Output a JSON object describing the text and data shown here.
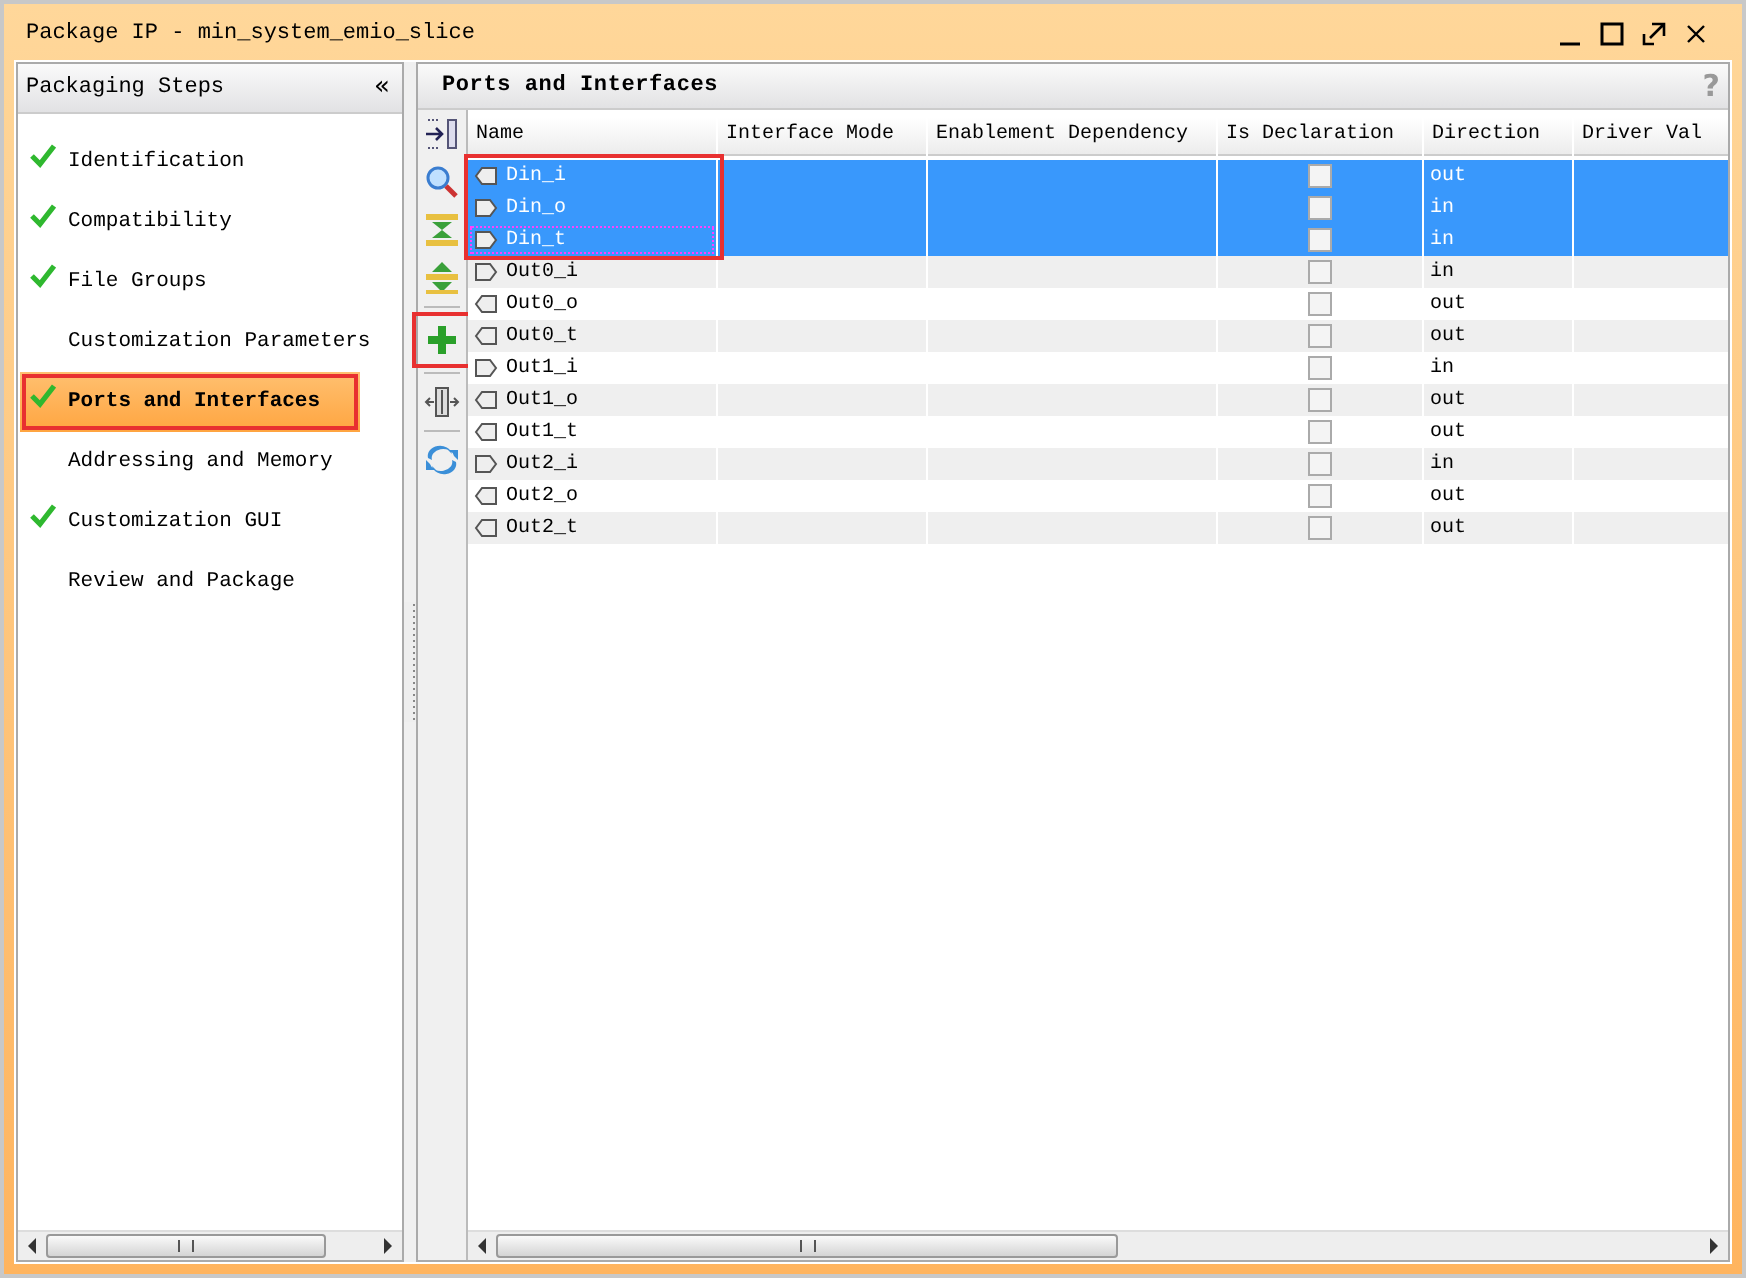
{
  "window": {
    "title": "Package IP - min_system_emio_slice"
  },
  "steps_panel": {
    "title": "Packaging Steps",
    "collapse": "«",
    "items": [
      {
        "label": "Identification",
        "done": true,
        "selected": false,
        "highlighted": false
      },
      {
        "label": "Compatibility",
        "done": true,
        "selected": false,
        "highlighted": false
      },
      {
        "label": "File Groups",
        "done": true,
        "selected": false,
        "highlighted": false
      },
      {
        "label": "Customization Parameters",
        "done": false,
        "selected": false,
        "highlighted": false
      },
      {
        "label": "Ports and Interfaces",
        "done": true,
        "selected": true,
        "highlighted": true
      },
      {
        "label": "Addressing and Memory",
        "done": false,
        "selected": false,
        "highlighted": false
      },
      {
        "label": "Customization GUI",
        "done": true,
        "selected": false,
        "highlighted": false
      },
      {
        "label": "Review and Package",
        "done": false,
        "selected": false,
        "highlighted": false
      }
    ]
  },
  "main_panel": {
    "title": "Ports and Interfaces",
    "help": "?"
  },
  "toolbar": [
    {
      "kind": "collapse",
      "highlighted": false
    },
    {
      "kind": "search",
      "highlighted": false
    },
    {
      "kind": "expand",
      "highlighted": false
    },
    {
      "kind": "shrink",
      "highlighted": false
    },
    {
      "kind": "add",
      "highlighted": true
    },
    {
      "kind": "resize",
      "highlighted": false
    },
    {
      "kind": "refresh",
      "highlighted": false
    }
  ],
  "table": {
    "columns": [
      "Name",
      "Interface Mode",
      "Enablement Dependency",
      "Is Declaration",
      "Direction",
      "Driver Val"
    ],
    "rows": [
      {
        "name": "Din_i",
        "declaration": false,
        "direction": "out",
        "selected": true,
        "focused": false,
        "highlighted": true
      },
      {
        "name": "Din_o",
        "declaration": false,
        "direction": "in",
        "selected": true,
        "focused": false,
        "highlighted": true
      },
      {
        "name": "Din_t",
        "declaration": false,
        "direction": "in",
        "selected": true,
        "focused": true,
        "highlighted": true
      },
      {
        "name": "Out0_i",
        "declaration": false,
        "direction": "in",
        "selected": false,
        "focused": false,
        "highlighted": false
      },
      {
        "name": "Out0_o",
        "declaration": false,
        "direction": "out",
        "selected": false,
        "focused": false,
        "highlighted": false
      },
      {
        "name": "Out0_t",
        "declaration": false,
        "direction": "out",
        "selected": false,
        "focused": false,
        "highlighted": false
      },
      {
        "name": "Out1_i",
        "declaration": false,
        "direction": "in",
        "selected": false,
        "focused": false,
        "highlighted": false
      },
      {
        "name": "Out1_o",
        "declaration": false,
        "direction": "out",
        "selected": false,
        "focused": false,
        "highlighted": false
      },
      {
        "name": "Out1_t",
        "declaration": false,
        "direction": "out",
        "selected": false,
        "focused": false,
        "highlighted": false
      },
      {
        "name": "Out2_i",
        "declaration": false,
        "direction": "in",
        "selected": false,
        "focused": false,
        "highlighted": false
      },
      {
        "name": "Out2_o",
        "declaration": false,
        "direction": "out",
        "selected": false,
        "focused": false,
        "highlighted": false
      },
      {
        "name": "Out2_t",
        "declaration": false,
        "direction": "out",
        "selected": false,
        "focused": false,
        "highlighted": false
      }
    ]
  }
}
